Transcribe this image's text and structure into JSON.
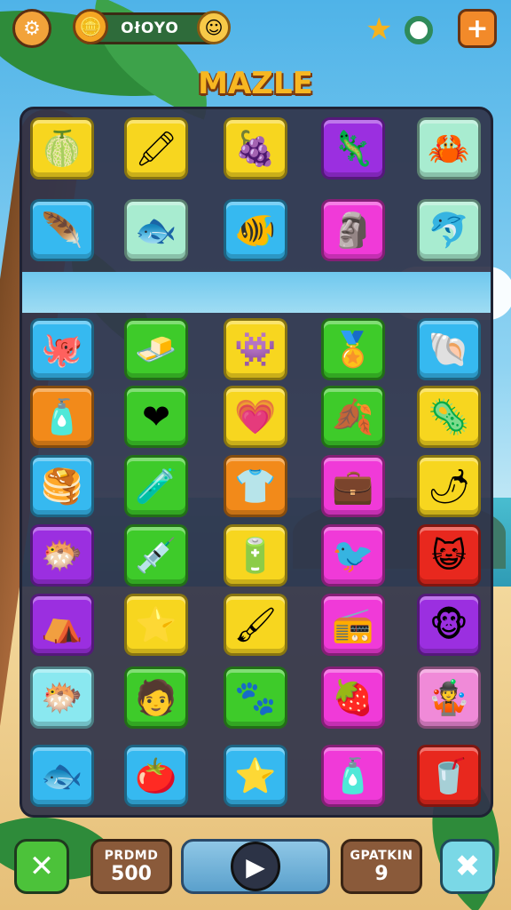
{
  "game": {
    "title": "MAZLE",
    "coins": "OłOYO",
    "top_icons": {
      "settings": "gear-icon",
      "coin": "coin-icon",
      "smiley": "smiley-icon",
      "star": "star-icon",
      "ring": "ring-icon",
      "add": "plus-icon"
    },
    "colors": {
      "yellow": "#f7d61f",
      "purple": "#9b2fe0",
      "mint": "#a8ecd0",
      "blue": "#36b9f0",
      "magenta": "#f03ad8",
      "green": "#3ecb2a",
      "orange": "#f28a1a",
      "red": "#e8281e",
      "pink": "#f08ad8",
      "cyan": "#8ae8f0"
    },
    "rows": [
      [
        {
          "icon": "🍈",
          "name": "melon",
          "color": "yellow"
        },
        {
          "icon": "🖍",
          "name": "crayon",
          "color": "yellow"
        },
        {
          "icon": "🍇",
          "name": "berry",
          "color": "yellow"
        },
        {
          "icon": "🦎",
          "name": "lizard",
          "color": "purple"
        },
        {
          "icon": "🦀",
          "name": "crab",
          "color": "mint"
        }
      ],
      [
        {
          "icon": "🪶",
          "name": "feather",
          "color": "blue"
        },
        {
          "icon": "🐟",
          "name": "fish",
          "color": "mint"
        },
        {
          "icon": "🐠",
          "name": "goldfish",
          "color": "blue"
        },
        {
          "icon": "🗿",
          "name": "statue",
          "color": "magenta"
        },
        {
          "icon": "🐬",
          "name": "dolphin",
          "color": "mint"
        }
      ],
      [
        {
          "icon": "🐙",
          "name": "octopus",
          "color": "blue"
        },
        {
          "icon": "🧈",
          "name": "butter",
          "color": "green"
        },
        {
          "icon": "👾",
          "name": "blob",
          "color": "yellow"
        },
        {
          "icon": "🏅",
          "name": "badge",
          "color": "green"
        },
        {
          "icon": "🐚",
          "name": "shell",
          "color": "blue"
        }
      ],
      [
        {
          "icon": "🧴",
          "name": "bottle",
          "color": "orange"
        },
        {
          "icon": "❤",
          "name": "heart",
          "color": "green"
        },
        {
          "icon": "💗",
          "name": "heart-pin",
          "color": "yellow"
        },
        {
          "icon": "🍂",
          "name": "leaf",
          "color": "green"
        },
        {
          "icon": "🦠",
          "name": "germ",
          "color": "yellow"
        }
      ],
      [
        {
          "icon": "🥞",
          "name": "pancake",
          "color": "blue"
        },
        {
          "icon": "🧪",
          "name": "vial",
          "color": "green"
        },
        {
          "icon": "👕",
          "name": "shirt",
          "color": "orange"
        },
        {
          "icon": "💼",
          "name": "suitcase",
          "color": "magenta"
        },
        {
          "icon": "🌶",
          "name": "pepper",
          "color": "yellow"
        }
      ],
      [
        {
          "icon": "🐡",
          "name": "pufferfish",
          "color": "purple"
        },
        {
          "icon": "💉",
          "name": "syringe",
          "color": "green"
        },
        {
          "icon": "🔋",
          "name": "battery",
          "color": "yellow"
        },
        {
          "icon": "🐦",
          "name": "bird",
          "color": "magenta"
        },
        {
          "icon": "😺",
          "name": "cat-face",
          "color": "red"
        }
      ],
      [
        {
          "icon": "⛺",
          "name": "tent",
          "color": "purple"
        },
        {
          "icon": "⭐",
          "name": "star",
          "color": "yellow"
        },
        {
          "icon": "🖌",
          "name": "paint-tube",
          "color": "yellow"
        },
        {
          "icon": "📻",
          "name": "radio",
          "color": "magenta"
        },
        {
          "icon": "🐵",
          "name": "monkey-face",
          "color": "purple"
        }
      ],
      [
        {
          "icon": "🐡",
          "name": "blowfish",
          "color": "cyan"
        },
        {
          "icon": "🧑",
          "name": "character",
          "color": "green"
        },
        {
          "icon": "🐾",
          "name": "creature",
          "color": "green"
        },
        {
          "icon": "🍓",
          "name": "strawberry",
          "color": "magenta"
        },
        {
          "icon": "🤹",
          "name": "juggler",
          "color": "pink"
        }
      ],
      [
        {
          "icon": "🐟",
          "name": "red-fish",
          "color": "blue"
        },
        {
          "icon": "🍅",
          "name": "tomato",
          "color": "blue"
        },
        {
          "icon": "⭐",
          "name": "gold-star",
          "color": "blue"
        },
        {
          "icon": "🧴",
          "name": "tube",
          "color": "magenta"
        },
        {
          "icon": "🥤",
          "name": "cup",
          "color": "red"
        }
      ]
    ]
  },
  "bottom": {
    "left_button_icon": "wrench-icon",
    "score_label": "PRDMD",
    "score_value": "500",
    "play_icon": "play-icon",
    "moves_label": "GPATKIN",
    "moves_value": "9",
    "right_button_icon": "tools-icon"
  }
}
